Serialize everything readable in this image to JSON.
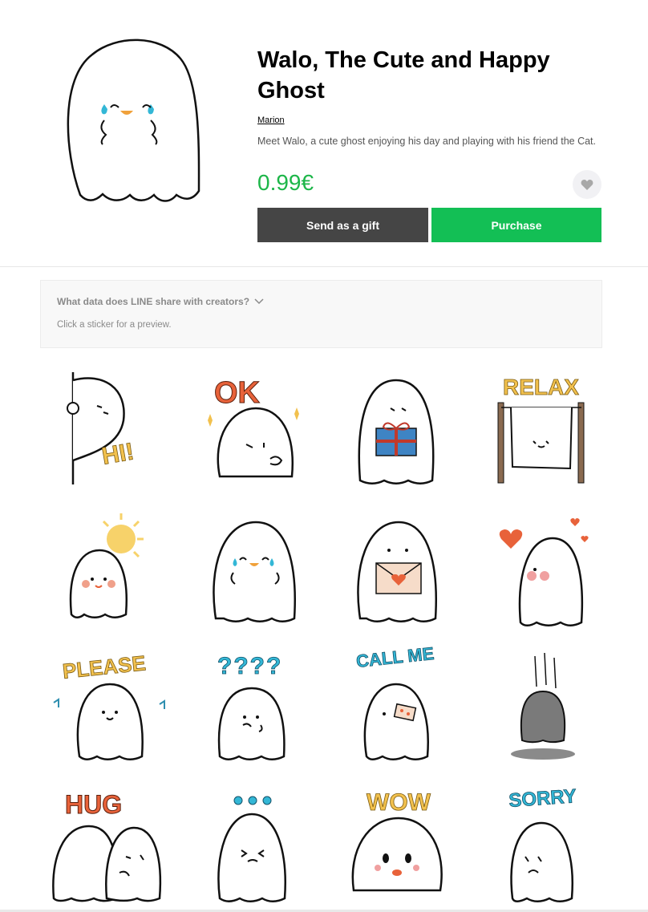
{
  "product": {
    "title": "Walo, The Cute and Happy Ghost",
    "author": "Marion",
    "description": "Meet Walo, a cute ghost enjoying his day and playing with his friend the Cat.",
    "price": "0.99€"
  },
  "actions": {
    "gift_label": "Send as a gift",
    "purchase_label": "Purchase",
    "favorite_icon": "heart-icon"
  },
  "info": {
    "question": "What data does LINE share with creators?",
    "hint": "Click a sticker for a preview."
  },
  "stickers": [
    {
      "caption": "HI!",
      "icon": "ghost-peeking-hi"
    },
    {
      "caption": "OK",
      "icon": "ghost-ok"
    },
    {
      "caption": "",
      "icon": "ghost-gift-box"
    },
    {
      "caption": "RELAX",
      "icon": "ghost-relax-hanging"
    },
    {
      "caption": "",
      "icon": "ghost-sun"
    },
    {
      "caption": "",
      "icon": "ghost-happy-tears"
    },
    {
      "caption": "",
      "icon": "ghost-love-letter"
    },
    {
      "caption": "",
      "icon": "ghost-hearts-blush"
    },
    {
      "caption": "PLEASE",
      "icon": "ghost-please"
    },
    {
      "caption": "????",
      "icon": "ghost-confused"
    },
    {
      "caption": "CALL ME",
      "icon": "ghost-call-me"
    },
    {
      "caption": "",
      "icon": "ghost-falling-gray"
    },
    {
      "caption": "HUG",
      "icon": "ghost-hug"
    },
    {
      "caption": "...",
      "icon": "ghost-dots"
    },
    {
      "caption": "WOW",
      "icon": "ghost-wow"
    },
    {
      "caption": "SORRY",
      "icon": "ghost-sorry"
    }
  ],
  "colors": {
    "price": "#1db649",
    "purchase": "#13bf55",
    "gift": "#454545",
    "caption_orange": "#e8623a",
    "caption_yellow": "#f2c14e",
    "caption_teal": "#2f8fb0",
    "tear_blue": "#33b7d6"
  }
}
